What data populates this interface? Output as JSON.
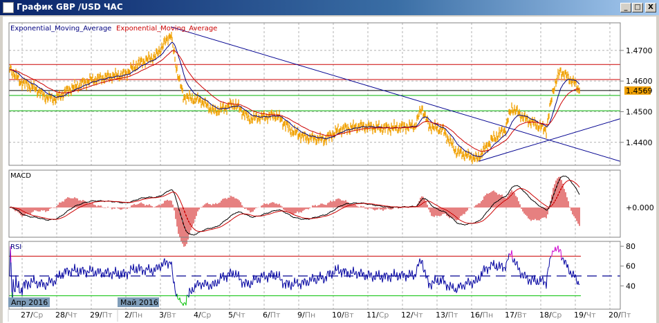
{
  "window": {
    "title": "График GBP /USD  ЧАС",
    "minimize": "_",
    "maximize": "□",
    "close": "X"
  },
  "legend": {
    "ema_fast": "Exponential_Moving_Average",
    "ema_slow": "Exponential_Moving_Average"
  },
  "panels": {
    "macd_label": "MACD",
    "rsi_label": "RSI"
  },
  "colors": {
    "price": "#f0a000",
    "ema_fast": "#000080",
    "ema_slow": "#cc0000",
    "macd": "#000000",
    "signal": "#cc0000",
    "rsi": "#0000a0",
    "rsi_high": "#cc00cc",
    "rsi_low": "#00c000",
    "grid": "#b0b0b0"
  },
  "chart_data": {
    "type": "line",
    "title": "GBP/USD H1",
    "x_unit": "trading day index (0 = 27/Ср)",
    "price_ticks": [
      "1.4700",
      "1.4600",
      "1.4500",
      "1.4400"
    ],
    "price_tick_values": [
      1.47,
      1.46,
      1.45,
      1.44
    ],
    "ylim": [
      1.4325,
      1.479
    ],
    "last_price": "1.4569",
    "price_keypoints": [
      [
        -0.38,
        1.4645
      ],
      [
        -0.04,
        1.4597
      ],
      [
        0.36,
        1.4578
      ],
      [
        0.66,
        1.4549
      ],
      [
        0.96,
        1.4542
      ],
      [
        1.36,
        1.4573
      ],
      [
        1.96,
        1.4602
      ],
      [
        2.56,
        1.4616
      ],
      [
        2.96,
        1.4621
      ],
      [
        3.36,
        1.4657
      ],
      [
        3.86,
        1.4681
      ],
      [
        4.3,
        1.4753
      ],
      [
        4.46,
        1.4645
      ],
      [
        4.66,
        1.4549
      ],
      [
        5.16,
        1.4537
      ],
      [
        5.56,
        1.45
      ],
      [
        6.16,
        1.4525
      ],
      [
        6.56,
        1.4477
      ],
      [
        7.36,
        1.4489
      ],
      [
        7.76,
        1.4441
      ],
      [
        8.16,
        1.4417
      ],
      [
        8.76,
        1.441
      ],
      [
        9.16,
        1.4441
      ],
      [
        9.76,
        1.4453
      ],
      [
        10.56,
        1.4446
      ],
      [
        11.36,
        1.4453
      ],
      [
        11.56,
        1.4513
      ],
      [
        11.76,
        1.4453
      ],
      [
        12.16,
        1.4441
      ],
      [
        12.56,
        1.4369
      ],
      [
        13.16,
        1.4345
      ],
      [
        13.56,
        1.4405
      ],
      [
        13.96,
        1.4441
      ],
      [
        14.16,
        1.4513
      ],
      [
        14.56,
        1.4477
      ],
      [
        15.16,
        1.4441
      ],
      [
        15.36,
        1.4573
      ],
      [
        15.56,
        1.4633
      ],
      [
        15.96,
        1.4597
      ],
      [
        16.12,
        1.4569
      ]
    ],
    "horizontal_levels": [
      {
        "price": 1.4654,
        "color": "#cc0000"
      },
      {
        "price": 1.4605,
        "color": "#cc0000"
      },
      {
        "price": 1.4569,
        "color": "#000000"
      },
      {
        "price": 1.4553,
        "color": "#00b000"
      },
      {
        "price": 1.4503,
        "color": "#00b000"
      }
    ],
    "trendlines": [
      {
        "from": [
          4.3,
          1.4777
        ],
        "to": [
          17.3,
          1.4338
        ]
      },
      {
        "from": [
          13.2,
          1.4338
        ],
        "to": [
          17.3,
          1.4477
        ]
      }
    ],
    "macd_tick": "+0.000",
    "rsi_ticks": [
      "80",
      "60",
      "40"
    ],
    "rsi_tick_values": [
      80,
      60,
      40
    ],
    "rsi_levels": {
      "high": 70,
      "mid": 50,
      "low": 30
    },
    "months": [
      {
        "label": "Апр 2016",
        "day": -0.4
      },
      {
        "label": "Май 2016",
        "day": 2.76
      }
    ],
    "days": [
      {
        "num": "27/",
        "dow": "Ср"
      },
      {
        "num": "28/",
        "dow": "Чт"
      },
      {
        "num": "29/",
        "dow": "Пт"
      },
      {
        "num": "2/",
        "dow": "Пн"
      },
      {
        "num": "3/",
        "dow": "Вт"
      },
      {
        "num": "4/",
        "dow": "Ср"
      },
      {
        "num": "5/",
        "dow": "Чт"
      },
      {
        "num": "6/",
        "dow": "Пт"
      },
      {
        "num": "9/",
        "dow": "Пн"
      },
      {
        "num": "10/",
        "dow": "Вт"
      },
      {
        "num": "11/",
        "dow": "Ср"
      },
      {
        "num": "12/",
        "dow": "Чт"
      },
      {
        "num": "13/",
        "dow": "Пт"
      },
      {
        "num": "16/",
        "dow": "Пн"
      },
      {
        "num": "17/",
        "dow": "Вт"
      },
      {
        "num": "18/",
        "dow": "Ср"
      },
      {
        "num": "19/",
        "dow": "Чт"
      },
      {
        "num": "20/",
        "dow": "Пт"
      }
    ]
  }
}
